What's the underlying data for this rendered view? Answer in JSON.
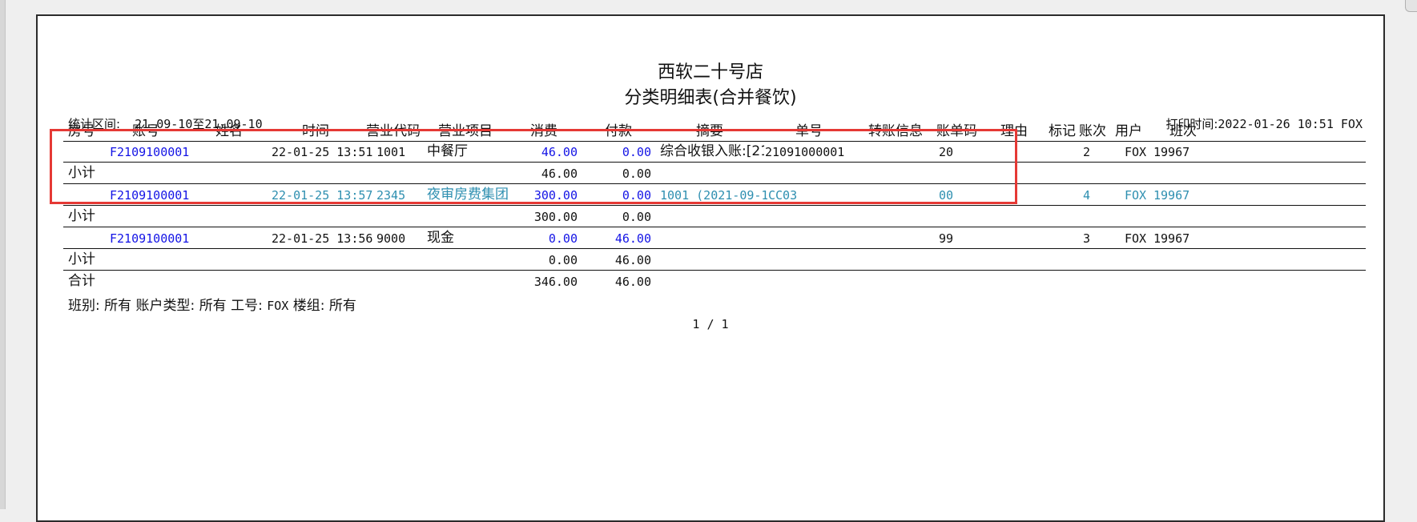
{
  "report": {
    "store_name": "西软二十号店",
    "report_title": "分类明细表(合并餐饮)",
    "period_label": "统计区间:",
    "period_value": "21-09-10至21-09-10",
    "print_time_label": "打印时间:",
    "print_time_value": "2022-01-26 10:51 FOX"
  },
  "table": {
    "headers": [
      "房号",
      "账号",
      "姓名",
      "时间",
      "营业代码",
      "营业项目",
      "消费",
      "付款",
      "摘要",
      "单号",
      "转账信息",
      "账单码",
      "理由",
      "标记",
      "账次",
      "用户",
      "班次"
    ],
    "groups": [
      {
        "row": {
          "room": "",
          "account": "F2109100001",
          "name": "",
          "time": "22-01-25 13:51",
          "code": "1001",
          "item": "中餐厅",
          "consume": "46.00",
          "payment": "0.00",
          "summary": "综合收银入账:[21(",
          "doc_no": "21091000001",
          "transfer": "",
          "bill_code": "20",
          "reason": "",
          "mark": "",
          "seq": "2",
          "user": "FOX",
          "shift": "19967"
        },
        "subtotal_label": "小计",
        "subtotal_consume": "46.00",
        "subtotal_payment": "0.00"
      },
      {
        "row": {
          "room": "",
          "account": "F2109100001",
          "name": "",
          "time": "22-01-25 13:57",
          "code": "2345",
          "item": "夜审房费集团",
          "consume": "300.00",
          "payment": "0.00",
          "summary": "1001 (2021-09-10",
          "doc_no": "CC03",
          "transfer": "",
          "bill_code": "00",
          "reason": "",
          "mark": "",
          "seq": "4",
          "user": "FOX",
          "shift": "19967"
        },
        "subtotal_label": "小计",
        "subtotal_consume": "300.00",
        "subtotal_payment": "0.00"
      },
      {
        "row": {
          "room": "",
          "account": "F2109100001",
          "name": "",
          "time": "22-01-25 13:56",
          "code": "9000",
          "item": "现金",
          "consume": "0.00",
          "payment": "46.00",
          "summary": "",
          "doc_no": "",
          "transfer": "",
          "bill_code": "99",
          "reason": "",
          "mark": "",
          "seq": "3",
          "user": "FOX",
          "shift": "19967"
        },
        "subtotal_label": "小计",
        "subtotal_consume": "0.00",
        "subtotal_payment": "46.00"
      }
    ],
    "total_label": "合计",
    "total_consume": "346.00",
    "total_payment": "46.00"
  },
  "filters": {
    "shift_label": "班别:",
    "shift_value": "所有",
    "account_type_label": "账户类型:",
    "account_type_value": "所有",
    "employee_label": "工号:",
    "employee_value": "FOX",
    "building_label": "楼组:",
    "building_value": "所有"
  },
  "pagination": {
    "text": "1 / 1"
  },
  "colors": {
    "highlight_box": "#e53935",
    "link_blue": "#1414e6",
    "teal_row": "#2e8fb0"
  }
}
